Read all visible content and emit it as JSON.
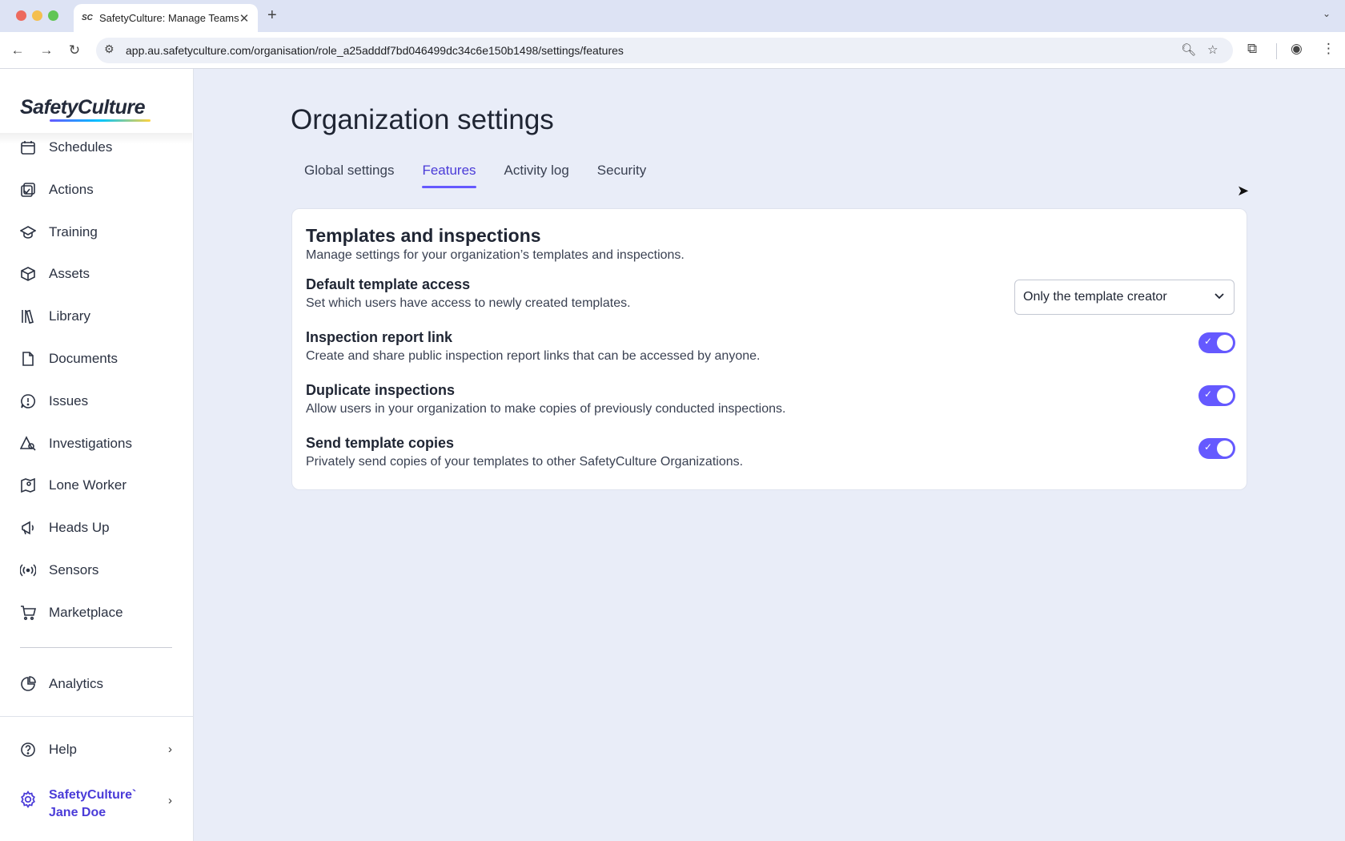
{
  "browser": {
    "tab_title": "SafetyCulture: Manage Teams",
    "tab_favicon": "SC",
    "url": "app.au.safetyculture.com/organisation/role_a25adddf7bd046499dc34c6e150b1498/settings/features"
  },
  "sidebar": {
    "logo": "SafetyCulture",
    "items": [
      {
        "label": "Schedules",
        "icon": "calendar-icon"
      },
      {
        "label": "Actions",
        "icon": "actions-icon"
      },
      {
        "label": "Training",
        "icon": "graduation-cap-icon"
      },
      {
        "label": "Assets",
        "icon": "cube-icon"
      },
      {
        "label": "Library",
        "icon": "library-icon"
      },
      {
        "label": "Documents",
        "icon": "document-icon"
      },
      {
        "label": "Issues",
        "icon": "issue-icon"
      },
      {
        "label": "Investigations",
        "icon": "investigation-icon"
      },
      {
        "label": "Lone Worker",
        "icon": "map-icon"
      },
      {
        "label": "Heads Up",
        "icon": "megaphone-icon"
      },
      {
        "label": "Sensors",
        "icon": "sensor-icon"
      },
      {
        "label": "Marketplace",
        "icon": "cart-icon"
      }
    ],
    "analytics": "Analytics",
    "help": "Help",
    "org_line1": "SafetyCulture`",
    "org_line2": "Jane Doe"
  },
  "main": {
    "title": "Organization settings",
    "tabs": [
      "Global settings",
      "Features",
      "Activity log",
      "Security"
    ],
    "active_tab": "Features",
    "card": {
      "title": "Templates and inspections",
      "subtitle": "Manage settings for your organization’s templates and inspections.",
      "rows": [
        {
          "title": "Default template access",
          "desc": "Set which users have access to newly created templates.",
          "control": "select",
          "value": "Only the template creator"
        },
        {
          "title": "Inspection report link",
          "desc": "Create and share public inspection report links that can be accessed by anyone.",
          "control": "toggle",
          "on": true
        },
        {
          "title": "Duplicate inspections",
          "desc": "Allow users in your organization to make copies of previously conducted inspections.",
          "control": "toggle",
          "on": true
        },
        {
          "title": "Send template copies",
          "desc": "Privately send copies of your templates to other SafetyCulture Organizations.",
          "control": "toggle",
          "on": true
        }
      ]
    }
  },
  "colors": {
    "accent": "#6559ff",
    "accent_text": "#4a3bd8",
    "background": "#e9edf8"
  }
}
